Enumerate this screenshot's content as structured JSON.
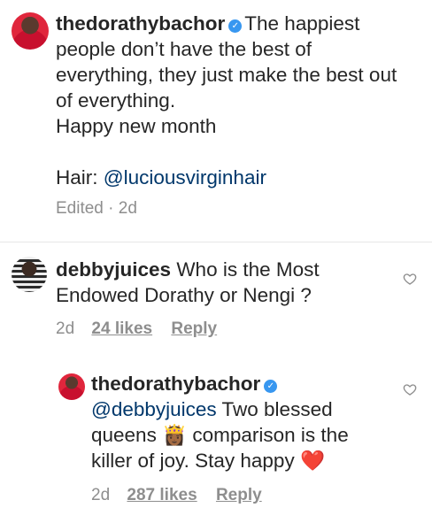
{
  "caption": {
    "username": "thedorathybachor",
    "line1": "The happiest",
    "line2": "people don’t have the best of",
    "line3": "everything, they just make the best out",
    "line4": "of everything.",
    "line5": "Happy new month",
    "hair_label": "Hair:",
    "hair_mention": "@luciousvirginhair",
    "meta": "Edited · 2d"
  },
  "comment": {
    "username": "debbyjuices",
    "text1": "Who is the Most",
    "text2": "Endowed Dorathy or Nengi ?",
    "time": "2d",
    "likes": "24 likes",
    "reply": "Reply"
  },
  "reply": {
    "username": "thedorathybachor",
    "mention": "@debbyjuices",
    "text1": "Two blessed",
    "text2a": "queens",
    "emoji_queen": "👸🏾",
    "text2b": "comparison is the",
    "text3": "killer of joy. Stay happy",
    "emoji_heart": "❤️",
    "time": "2d",
    "likes": "287 likes",
    "reply": "Reply"
  },
  "colors": {
    "verified": "#3897f0",
    "mention": "#00376b",
    "muted": "#8e8e8e"
  },
  "icons": [
    "verified-badge-icon",
    "heart-icon"
  ]
}
